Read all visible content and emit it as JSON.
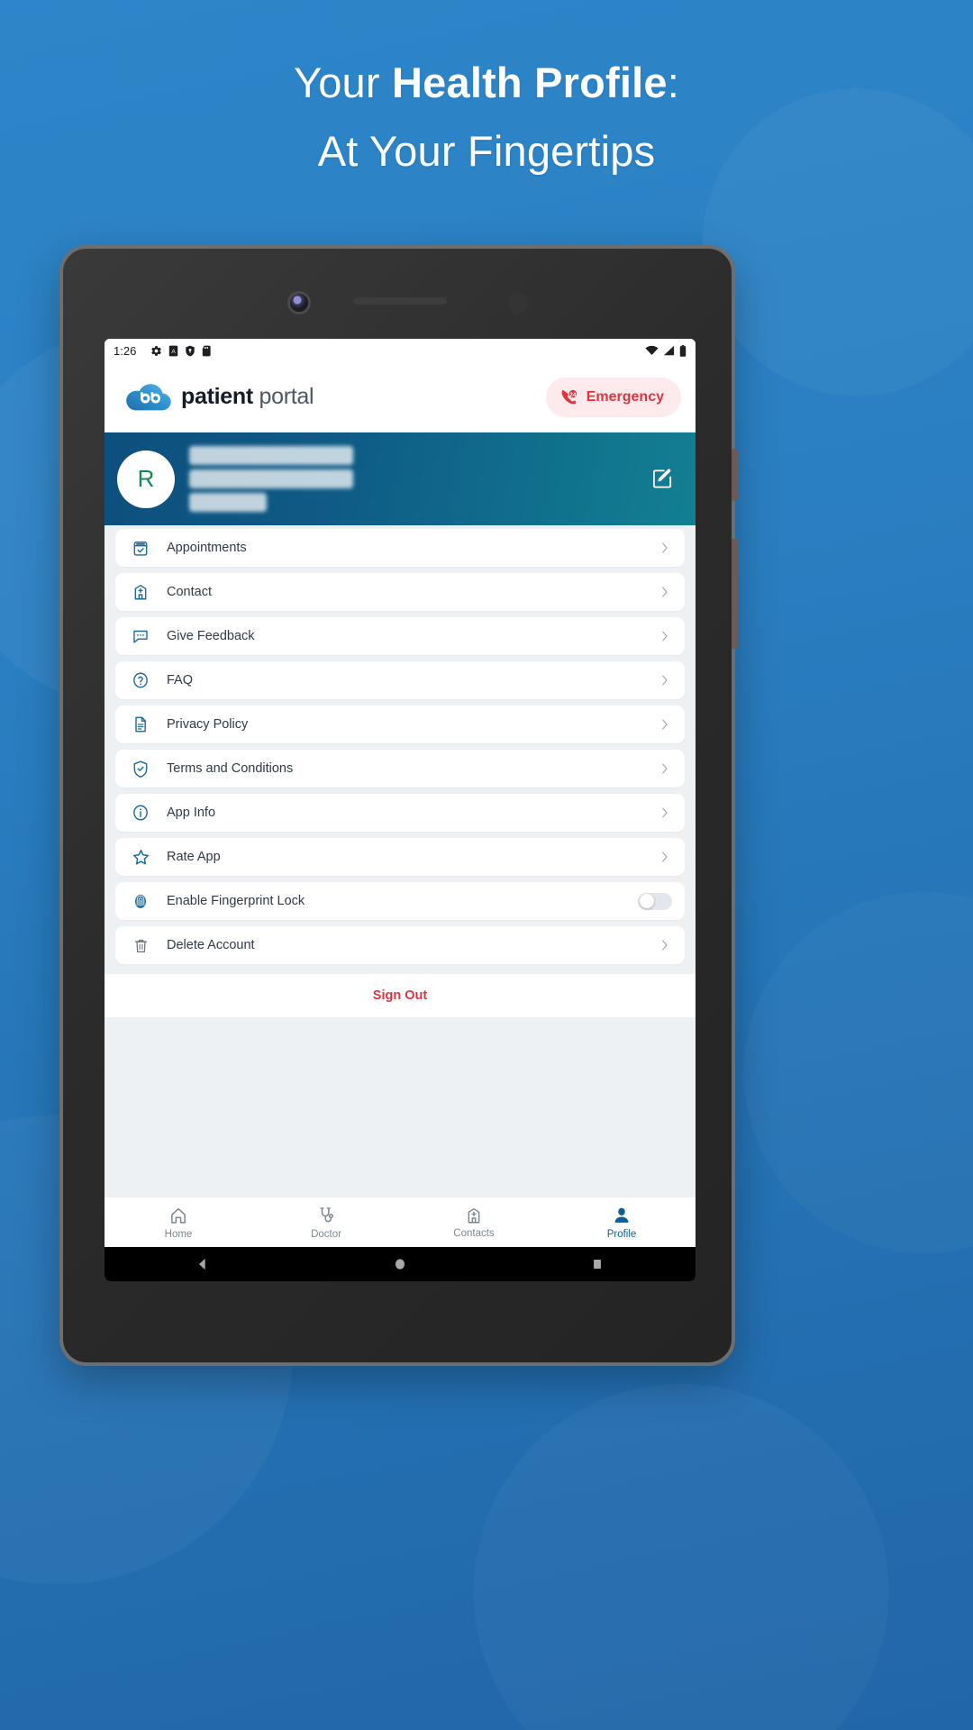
{
  "promo": {
    "headline_line1_plain": "Your ",
    "headline_line1_bold": "Health Profile",
    "headline_line1_tail": ":",
    "headline_line2": "At Your Fingertips",
    "background_color": "#2980c4",
    "headline_color": "#ffffff"
  },
  "device": {
    "frame_color": "#2b2b2b",
    "bezel_color": "#6e6e6e"
  },
  "status_bar": {
    "clock": "1:26",
    "left_icons": [
      "gear-icon",
      "a-box-icon",
      "shield-icon",
      "sd-card-icon"
    ],
    "right_icons": [
      "wifi-icon",
      "cellular-signal-icon",
      "battery-icon"
    ]
  },
  "app_header": {
    "brand_bold": "patient",
    "brand_light": " portal",
    "logo_icon": "cloud-bb-logo-icon",
    "emergency": {
      "label": "Emergency",
      "badge_number": "24",
      "icon": "emergency-phone-24-icon",
      "text_color": "#e0343f",
      "background_color": "#fdeaec"
    }
  },
  "profile_banner": {
    "avatar_initial": "R",
    "avatar_initial_color": "#128a53",
    "redacted_fields": [
      "name-redacted",
      "email-redacted",
      "phone-redacted"
    ],
    "edit_icon": "edit-pencil-square-icon",
    "gradient_from": "#0d4f7d",
    "gradient_to": "#127f93"
  },
  "menu": {
    "items": [
      {
        "label": "Appointments",
        "icon": "calendar-check-icon",
        "trailing": "chevron"
      },
      {
        "label": "Contact",
        "icon": "hospital-icon",
        "trailing": "chevron"
      },
      {
        "label": "Give Feedback",
        "icon": "chat-bubble-icon",
        "trailing": "chevron"
      },
      {
        "label": "FAQ",
        "icon": "question-circle-icon",
        "trailing": "chevron"
      },
      {
        "label": "Privacy Policy",
        "icon": "document-icon",
        "trailing": "chevron"
      },
      {
        "label": "Terms and Conditions",
        "icon": "shield-check-icon",
        "trailing": "chevron"
      },
      {
        "label": "App Info",
        "icon": "info-circle-icon",
        "trailing": "chevron"
      },
      {
        "label": "Rate App",
        "icon": "star-icon",
        "trailing": "chevron"
      },
      {
        "label": "Enable Fingerprint Lock",
        "icon": "fingerprint-icon",
        "trailing": "toggle",
        "toggle_on": false
      },
      {
        "label": "Delete Account",
        "icon": "trash-icon",
        "trailing": "chevron"
      }
    ],
    "sign_out_label": "Sign Out",
    "sign_out_color": "#e0343f"
  },
  "bottom_nav": {
    "active_color": "#0d5f93",
    "inactive_color": "#7b858f",
    "items": [
      {
        "label": "Home",
        "icon": "home-icon",
        "active": false
      },
      {
        "label": "Doctor",
        "icon": "stethoscope-icon",
        "active": false
      },
      {
        "label": "Contacts",
        "icon": "hospital-icon",
        "active": false
      },
      {
        "label": "Profile",
        "icon": "person-icon",
        "active": true
      }
    ]
  },
  "android_nav": {
    "buttons": [
      "back-triangle-icon",
      "home-circle-icon",
      "recents-square-icon"
    ]
  }
}
